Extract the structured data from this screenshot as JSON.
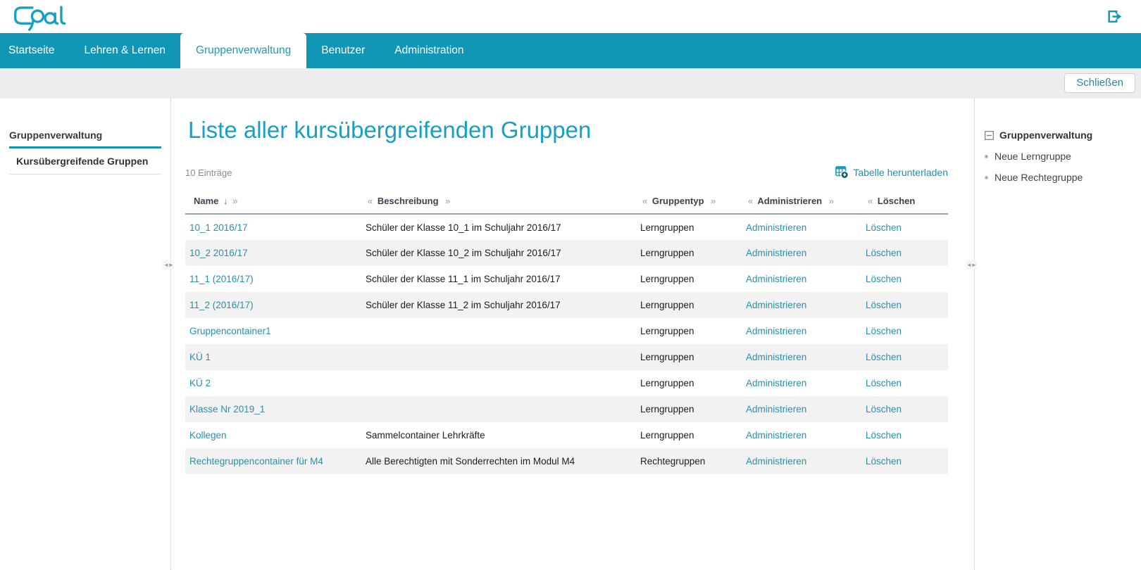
{
  "brand": {
    "name": "Opal"
  },
  "navbar": {
    "tabs": [
      {
        "label": "Startseite",
        "active": false
      },
      {
        "label": "Lehren & Lernen",
        "active": false
      },
      {
        "label": "Gruppenverwaltung",
        "active": true
      },
      {
        "label": "Benutzer",
        "active": false
      },
      {
        "label": "Administration",
        "active": false
      }
    ]
  },
  "subbar": {
    "close_label": "Schließen"
  },
  "left_sidebar": {
    "section_label": "Gruppenverwaltung",
    "items": [
      {
        "label": "Kursübergreifende Gruppen",
        "active": true
      }
    ]
  },
  "main": {
    "title": "Liste aller kursübergreifenden Gruppen",
    "entries_label": "10 Einträge",
    "download_label": "Tabelle herunterladen",
    "table": {
      "administer_label": "Administrieren",
      "delete_label": "Löschen",
      "columns": [
        {
          "pre": "",
          "label": "Name",
          "sort_arrow": "↓",
          "post": "»"
        },
        {
          "pre": "«",
          "label": "Beschreibung",
          "sort_arrow": "",
          "post": "»"
        },
        {
          "pre": "«",
          "label": "Gruppentyp",
          "sort_arrow": "",
          "post": "»"
        },
        {
          "pre": "«",
          "label": "Administrieren",
          "sort_arrow": "",
          "post": "»"
        },
        {
          "pre": "«",
          "label": "Löschen",
          "sort_arrow": "",
          "post": ""
        }
      ],
      "rows": [
        {
          "name": "10_1 2016/17",
          "description": "Schüler der Klasse 10_1 im Schuljahr 2016/17",
          "type": "Lerngruppen"
        },
        {
          "name": "10_2 2016/17",
          "description": "Schüler der Klasse 10_2 im Schuljahr 2016/17",
          "type": "Lerngruppen"
        },
        {
          "name": "11_1 (2016/17)",
          "description": "Schüler der Klasse 11_1 im Schuljahr 2016/17",
          "type": "Lerngruppen"
        },
        {
          "name": "11_2 (2016/17)",
          "description": "Schüler der Klasse 11_2 im Schuljahr 2016/17",
          "type": "Lerngruppen"
        },
        {
          "name": "Gruppencontainer1",
          "description": "",
          "type": "Lerngruppen"
        },
        {
          "name": "KÜ 1",
          "description": "",
          "type": "Lerngruppen"
        },
        {
          "name": "KÜ 2",
          "description": "",
          "type": "Lerngruppen"
        },
        {
          "name": "Klasse Nr 2019_1",
          "description": "",
          "type": "Lerngruppen"
        },
        {
          "name": "Kollegen",
          "description": "Sammelcontainer Lehrkräfte",
          "type": "Lerngruppen"
        },
        {
          "name": "Rechtegruppencontainer für M4",
          "description": "Alle Berechtigten mit Sonderrechten im Modul M4",
          "type": "Rechtegruppen"
        }
      ]
    }
  },
  "right_sidebar": {
    "section_label": "Gruppenverwaltung",
    "items": [
      {
        "label": "Neue Lerngruppe"
      },
      {
        "label": "Neue Rechtegruppe"
      }
    ]
  },
  "colors": {
    "brand_teal": "#1196b6",
    "title_teal": "#189fc2",
    "link_teal": "#2691ae",
    "stripe": "#f2f2f2"
  }
}
